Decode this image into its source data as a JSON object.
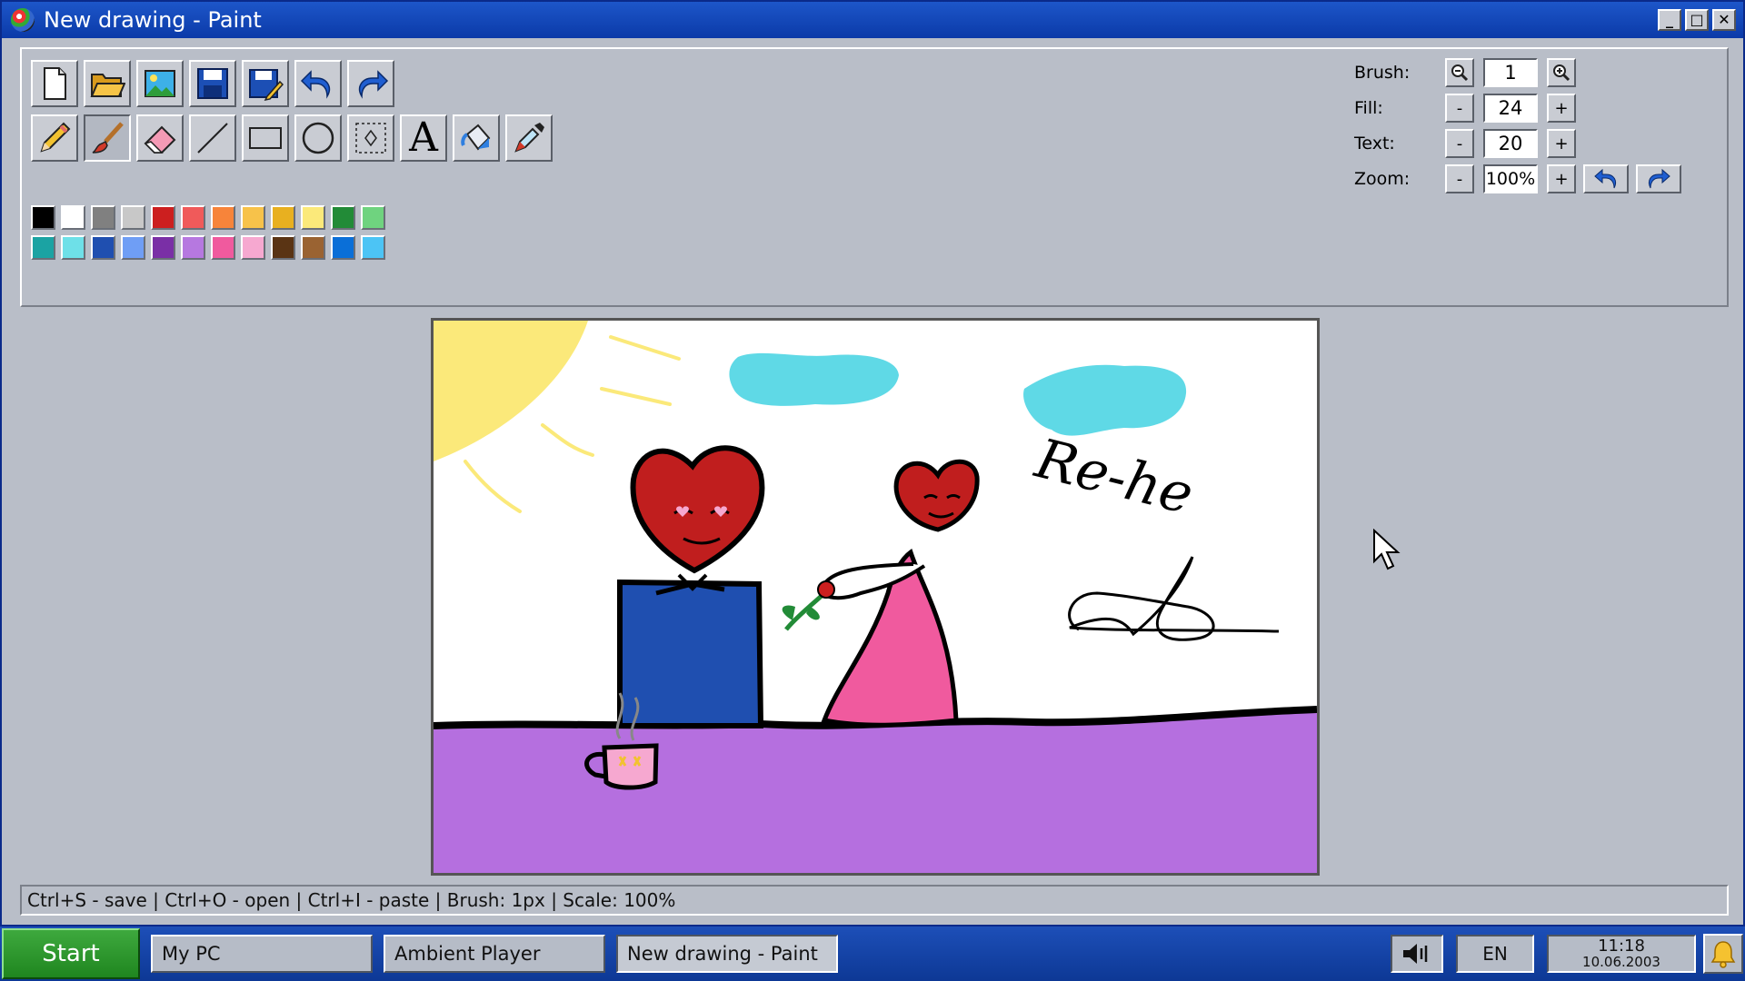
{
  "window": {
    "title": "New drawing - Paint",
    "buttons": {
      "minimize": "_",
      "maximize": "□",
      "close": "✕"
    }
  },
  "toolbar": {
    "row1": [
      {
        "name": "new-file-icon"
      },
      {
        "name": "open-folder-icon"
      },
      {
        "name": "insert-image-icon"
      },
      {
        "name": "save-icon"
      },
      {
        "name": "save-as-icon"
      },
      {
        "name": "undo-icon"
      },
      {
        "name": "redo-icon"
      }
    ],
    "row2": [
      {
        "name": "pencil-icon"
      },
      {
        "name": "brush-icon",
        "active": true
      },
      {
        "name": "eraser-icon"
      },
      {
        "name": "line-icon"
      },
      {
        "name": "rectangle-icon"
      },
      {
        "name": "ellipse-icon"
      },
      {
        "name": "selection-icon"
      },
      {
        "name": "text-icon",
        "glyph": "A"
      },
      {
        "name": "fill-bucket-icon"
      },
      {
        "name": "eyedropper-icon"
      }
    ]
  },
  "palette": {
    "selected_index": 0,
    "colors": [
      "#000000",
      "#ffffff",
      "#808080",
      "#c8c8c8",
      "#cc1f1f",
      "#f05a5a",
      "#f7843a",
      "#f7c24a",
      "#e8b020",
      "#fbe97a",
      "#228b37",
      "#6fd37f",
      "#1ba3a3",
      "#6ee0e8",
      "#1f4fb0",
      "#6f9ef5",
      "#7a2fa6",
      "#b678e0",
      "#f05a9e",
      "#f6a8d0",
      "#5a3414",
      "#9a6332",
      "#0a6fd8",
      "#4cc4f5"
    ]
  },
  "settings": {
    "brush": {
      "label": "Brush:",
      "value": "1"
    },
    "fill": {
      "label": "Fill:",
      "value": "24",
      "minus": "-",
      "plus": "+"
    },
    "text": {
      "label": "Text:",
      "value": "20",
      "minus": "-",
      "plus": "+"
    },
    "zoom": {
      "label": "Zoom:",
      "value": "100%",
      "minus": "-",
      "plus": "+"
    }
  },
  "statusbar": {
    "text": "Ctrl+S - save | Ctrl+O - open | Ctrl+I - paste | Brush: 1px | Scale: 100%"
  },
  "drawing": {
    "handwriting": "Re-he"
  },
  "taskbar": {
    "start": "Start",
    "items": [
      "My PC",
      "Ambient Player",
      "New drawing - Paint"
    ],
    "active_item": "New drawing - Paint",
    "language": "EN",
    "time": "11:18",
    "date": "10.06.2003"
  }
}
